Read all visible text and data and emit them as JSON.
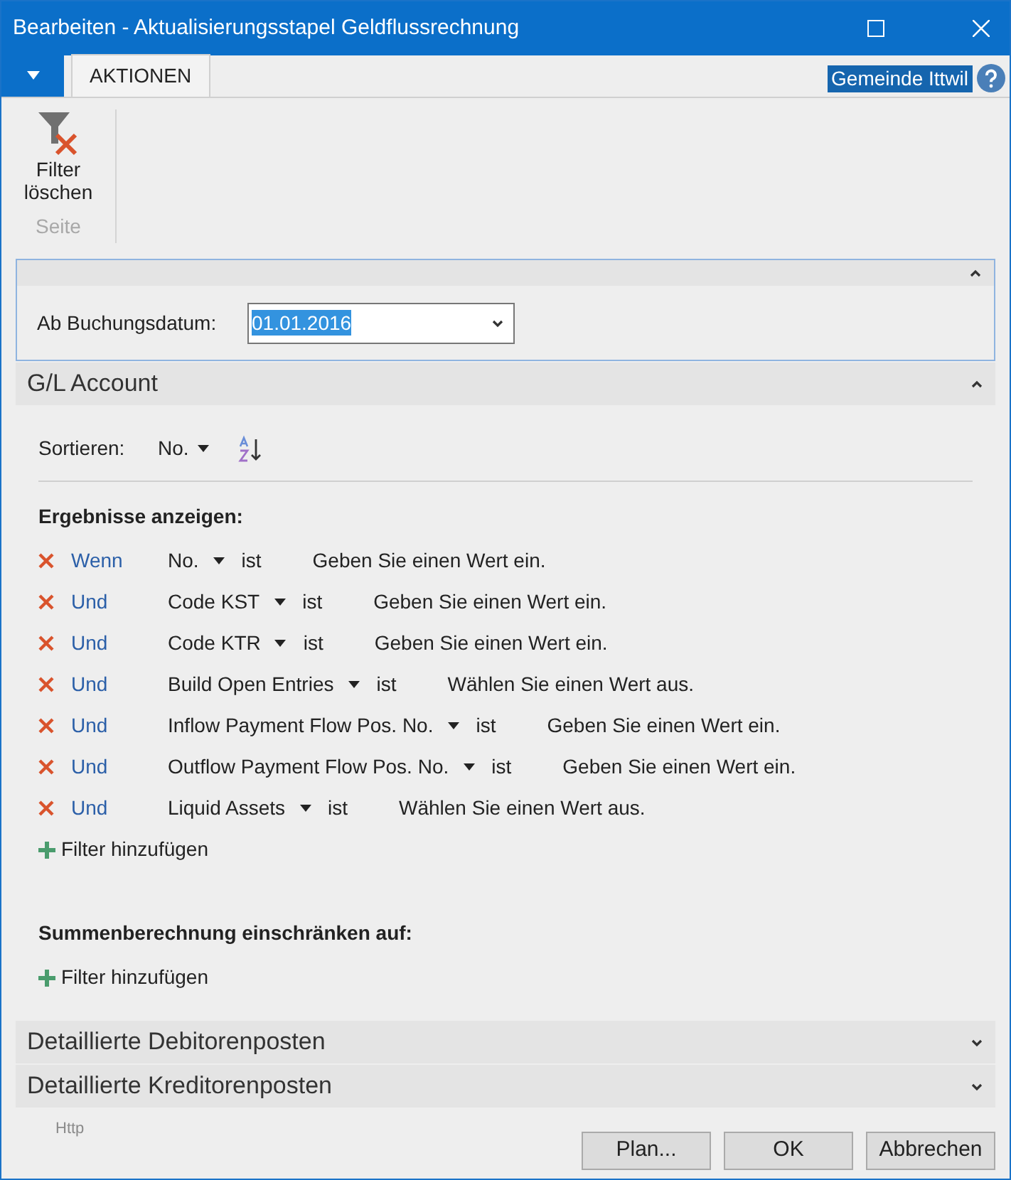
{
  "window": {
    "title": "Bearbeiten - Aktualisierungsstapel Geldflussrechnung"
  },
  "ribbon": {
    "tabs": [
      {
        "label": "AKTIONEN",
        "selected": true
      }
    ],
    "company": "Gemeinde Ittwil",
    "actions": [
      {
        "label": "Filter löschen"
      }
    ],
    "group": "Seite"
  },
  "options": {
    "expanded": true,
    "field": {
      "label": "Ab Buchungsdatum:",
      "value": "01.01.2016"
    }
  },
  "gl_account": {
    "title": "G/L Account",
    "expanded": true,
    "sort": {
      "label": "Sortieren:",
      "value": "No."
    },
    "results_title": "Ergebnisse anzeigen:",
    "filters": [
      {
        "conjunction": "Wenn",
        "field": "No.",
        "operator": "ist",
        "placeholder": "Geben Sie einen Wert ein."
      },
      {
        "conjunction": "Und",
        "field": "Code KST",
        "operator": "ist",
        "placeholder": "Geben Sie einen Wert ein."
      },
      {
        "conjunction": "Und",
        "field": "Code KTR",
        "operator": "ist",
        "placeholder": "Geben Sie einen Wert ein."
      },
      {
        "conjunction": "Und",
        "field": "Build Open Entries",
        "operator": "ist",
        "placeholder": "Wählen Sie einen Wert aus."
      },
      {
        "conjunction": "Und",
        "field": "Inflow Payment Flow Pos. No.",
        "operator": "ist",
        "placeholder": "Geben Sie einen Wert ein."
      },
      {
        "conjunction": "Und",
        "field": "Outflow Payment Flow Pos. No.",
        "operator": "ist",
        "placeholder": "Geben Sie einen Wert ein."
      },
      {
        "conjunction": "Und",
        "field": "Liquid Assets",
        "operator": "ist",
        "placeholder": "Wählen Sie einen Wert aus."
      }
    ],
    "add_filter": "Filter hinzufügen",
    "totals_title": "Summenberechnung einschränken auf:",
    "totals_add_filter": "Filter hinzufügen"
  },
  "collapsed_sections": [
    {
      "title": "Detaillierte Debitorenposten",
      "expanded": false
    },
    {
      "title": "Detaillierte Kreditorenposten",
      "expanded": false
    }
  ],
  "footer": {
    "link": "Http",
    "buttons": [
      "Plan...",
      "OK",
      "Abbrechen"
    ]
  }
}
